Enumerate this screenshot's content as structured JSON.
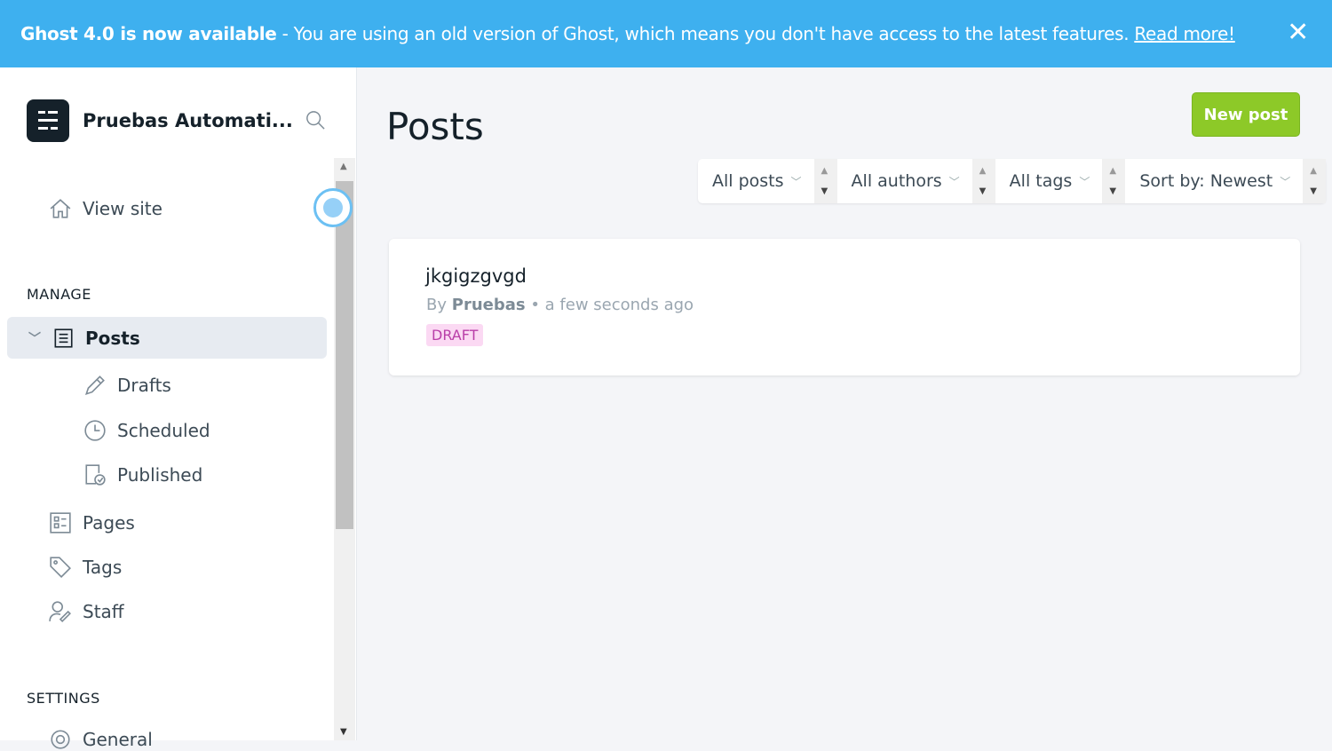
{
  "banner": {
    "title": "Ghost 4.0 is now available",
    "message": " - You are using an old version of Ghost, which means you don't have access to the latest features.",
    "link": "Read more!",
    "close": "✕"
  },
  "sidebar": {
    "site_name": "Pruebas Automati...",
    "view_site": "View site",
    "manage_heading": "MANAGE",
    "posts": "Posts",
    "drafts": "Drafts",
    "scheduled": "Scheduled",
    "published": "Published",
    "pages": "Pages",
    "tags": "Tags",
    "staff": "Staff",
    "settings_heading": "SETTINGS",
    "general": "General"
  },
  "main": {
    "title": "Posts",
    "new_post": "New post",
    "filters": [
      {
        "label": "All posts"
      },
      {
        "label": "All authors"
      },
      {
        "label": "All tags"
      },
      {
        "label": "Sort by: Newest"
      }
    ],
    "posts": [
      {
        "title": "jkgigzgvgd",
        "by": "By",
        "author": "Pruebas",
        "time": "• a few seconds ago",
        "status": "DRAFT"
      }
    ]
  }
}
